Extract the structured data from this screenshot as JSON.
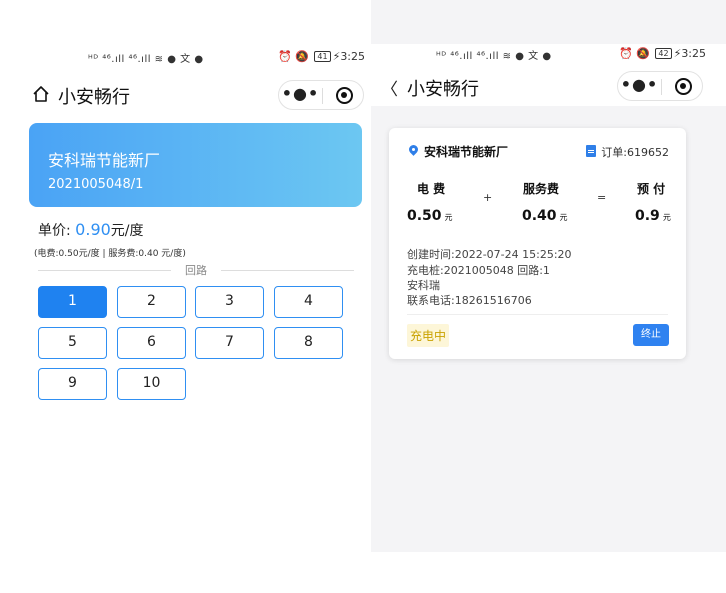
{
  "left": {
    "statusbar": {
      "signal": "ᴴᴰ ⁴⁶.ıll ⁴⁶.ıll ≋ ● 文 ●",
      "right": "⏰ 🔕",
      "battery": "41",
      "time": "3:25"
    },
    "nav": {
      "title": "小安畅行",
      "more": "•●•"
    },
    "station": {
      "name": "安科瑞节能新厂",
      "serial": "2021005048/1"
    },
    "price": {
      "label": "单价:",
      "value": "0.90",
      "unit": "元/度",
      "detail": "(电费:0.50元/度 | 服务费:0.40 元/度)"
    },
    "loop_label": "回路",
    "loops": [
      "1",
      "2",
      "3",
      "4",
      "5",
      "6",
      "7",
      "8",
      "9",
      "10"
    ],
    "selected_loop": "1"
  },
  "right": {
    "statusbar": {
      "signal": "ᴴᴰ ⁴⁶.ıll ⁴⁶.ıll ≋ ● 文 ●",
      "right": "⏰ 🔕",
      "battery": "42",
      "time": "3:25"
    },
    "nav": {
      "back": "〈",
      "title": "小安畅行",
      "more": "•●•"
    },
    "order": {
      "station": "安科瑞节能新厂",
      "order_label": "订单:",
      "order_no": "619652",
      "fees": {
        "elec_label": "电 费",
        "elec_value": "0.50",
        "elec_unit": "元",
        "plus": "+",
        "service_label": "服务费",
        "service_value": "0.40",
        "service_unit": "元",
        "equals": "=",
        "prepay_label": "预 付",
        "prepay_value": "0.9",
        "prepay_unit": "元"
      },
      "created": "创建时间:2022-07-24 15:25:20",
      "pile": "充电桩:2021005048 回路:1",
      "company": "安科瑞",
      "phone": "联系电话:18261516706",
      "status": "充电中",
      "stop_label": "终止"
    }
  },
  "colors": {
    "accent": "#1f82f0",
    "card_gradient_start": "#4aa3f5",
    "card_gradient_end": "#6cc7f2",
    "status_text": "#c9a200",
    "status_bg": "#fdf6d8"
  }
}
